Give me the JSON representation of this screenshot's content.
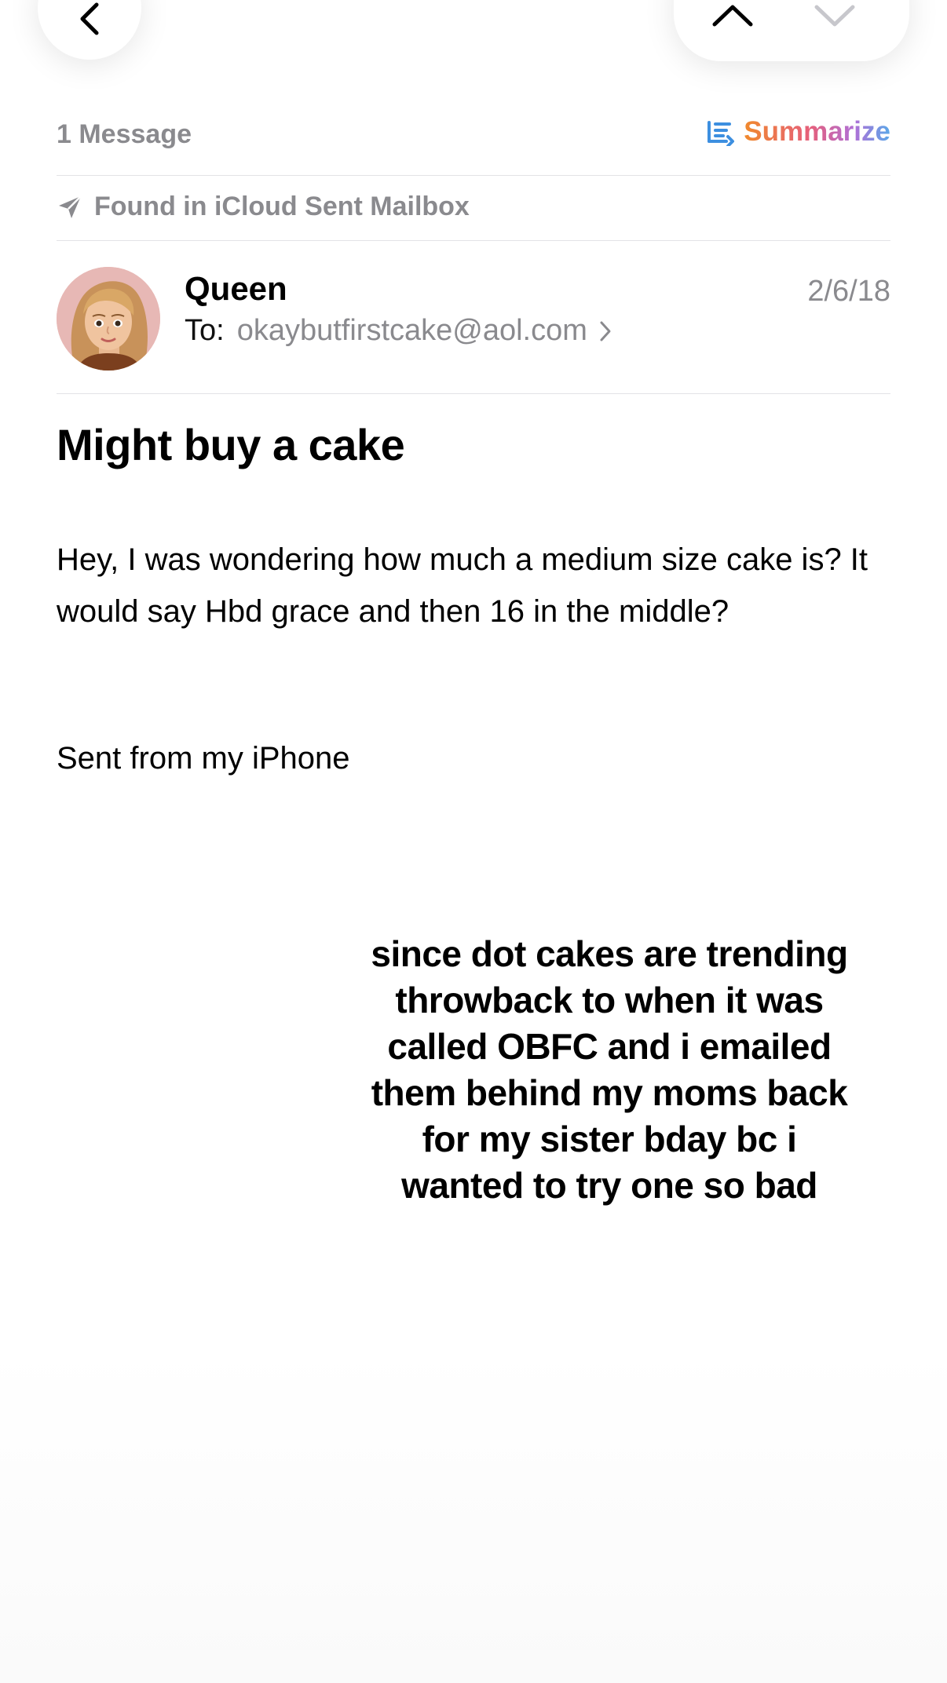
{
  "nav": {
    "back_icon": "chevron-left-icon",
    "prev_icon": "chevron-up-icon",
    "next_icon": "chevron-down-icon"
  },
  "header": {
    "message_count": "1 Message",
    "summarize_label": "Summarize",
    "summarize_icon": "summarize-lines-icon"
  },
  "mailbox": {
    "icon": "paper-plane-icon",
    "found_text": "Found in iCloud Sent Mailbox"
  },
  "sender": {
    "name": "Queen",
    "date": "2/6/18",
    "to_label": "To:",
    "to_address": "okaybutfirstcake@aol.com"
  },
  "email": {
    "subject": "Might buy a cake",
    "body": "Hey, I was wondering how much a medium size cake is? It would say Hbd grace and then 16 in the middle?",
    "signature": "Sent from my iPhone"
  },
  "caption": {
    "text": "since dot cakes are trending throwback to when it was called OBFC and i emailed them behind my moms back for my sister bday bc i wanted to try one so bad"
  },
  "colors": {
    "secondary_text": "#8a8a8e",
    "divider": "#e3e3e6",
    "summarize_gradient": [
      "#f08a2c",
      "#e65f7a",
      "#b06fd6",
      "#5aa8e8"
    ],
    "avatar_bg": "#e9b9b6"
  }
}
